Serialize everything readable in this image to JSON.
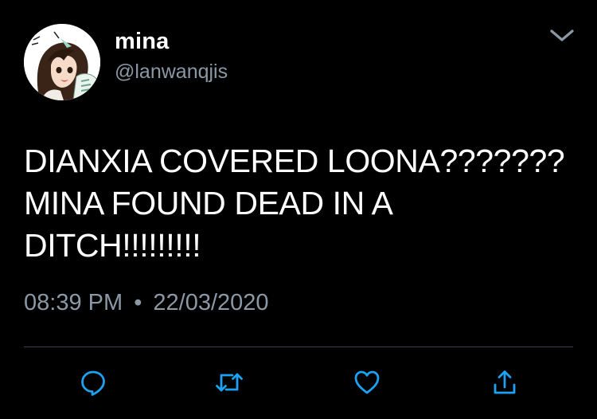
{
  "tweet": {
    "display_name": "mina",
    "handle": "@lanwanqjis",
    "text_lines": [
      "DIANXIA COVERED LOONA???????",
      "MINA FOUND DEAD IN A",
      "DITCH!!!!!!!!!"
    ],
    "time": "08:39 PM",
    "separator": "•",
    "date": "22/03/2020"
  },
  "icons": {
    "avatar": "avatar-image",
    "menu": "chevron-down-icon",
    "reply": "reply-icon",
    "retweet": "retweet-icon",
    "like": "heart-icon",
    "share": "share-icon"
  },
  "colors": {
    "background": "#000000",
    "text": "#ffffff",
    "secondary": "#8b98a5",
    "accent": "#1da1f2",
    "divider": "#38444d"
  }
}
